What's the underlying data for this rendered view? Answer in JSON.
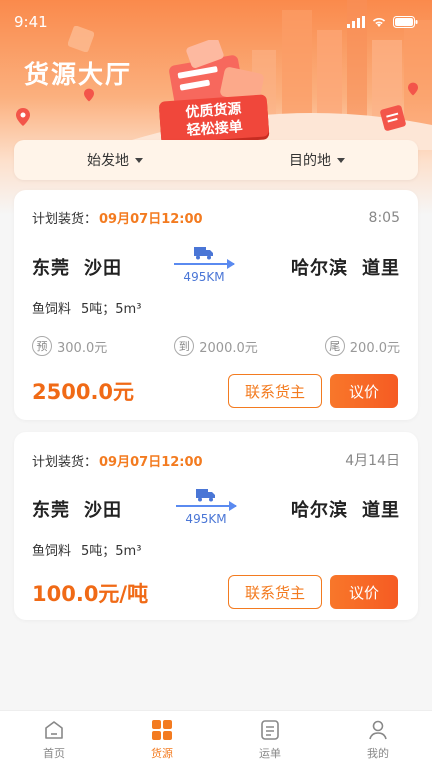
{
  "status_bar": {
    "time": "9:41"
  },
  "header": {
    "title": "货源大厅",
    "banner_text_line1": "优质货源",
    "banner_text_line2": "轻松接单"
  },
  "filters": {
    "origin_label": "始发地",
    "destination_label": "目的地"
  },
  "colors": {
    "accent": "#f37b20",
    "price": "#f06a16",
    "route": "#5a8af0"
  },
  "cards": [
    {
      "plan_label": "计划装货：",
      "plan_time": "09月07日12:00",
      "post_time": "8:05",
      "origin_city": "东莞",
      "origin_district": "沙田",
      "distance": "495KM",
      "dest_city": "哈尔滨",
      "dest_district": "道里",
      "cargo_name": "鱼饲料",
      "cargo_weight": "5吨；5m³",
      "fees": [
        {
          "icon": "预",
          "value": "300.0元"
        },
        {
          "icon": "到",
          "value": "2000.0元"
        },
        {
          "icon": "尾",
          "value": "200.0元"
        }
      ],
      "price": "2500.0元",
      "contact_label": "联系货主",
      "negotiate_label": "议价"
    },
    {
      "plan_label": "计划装货：",
      "plan_time": "09月07日12:00",
      "post_time": "4月14日",
      "origin_city": "东莞",
      "origin_district": "沙田",
      "distance": "495KM",
      "dest_city": "哈尔滨",
      "dest_district": "道里",
      "cargo_name": "鱼饲料",
      "cargo_weight": "5吨；5m³",
      "price": "100.0元/吨",
      "contact_label": "联系货主",
      "negotiate_label": "议价"
    }
  ],
  "tabbar": {
    "items": [
      {
        "label": "首页",
        "icon": "home-icon"
      },
      {
        "label": "货源",
        "icon": "grid-icon",
        "active": true
      },
      {
        "label": "运单",
        "icon": "waybill-icon"
      },
      {
        "label": "我的",
        "icon": "profile-icon"
      }
    ]
  }
}
